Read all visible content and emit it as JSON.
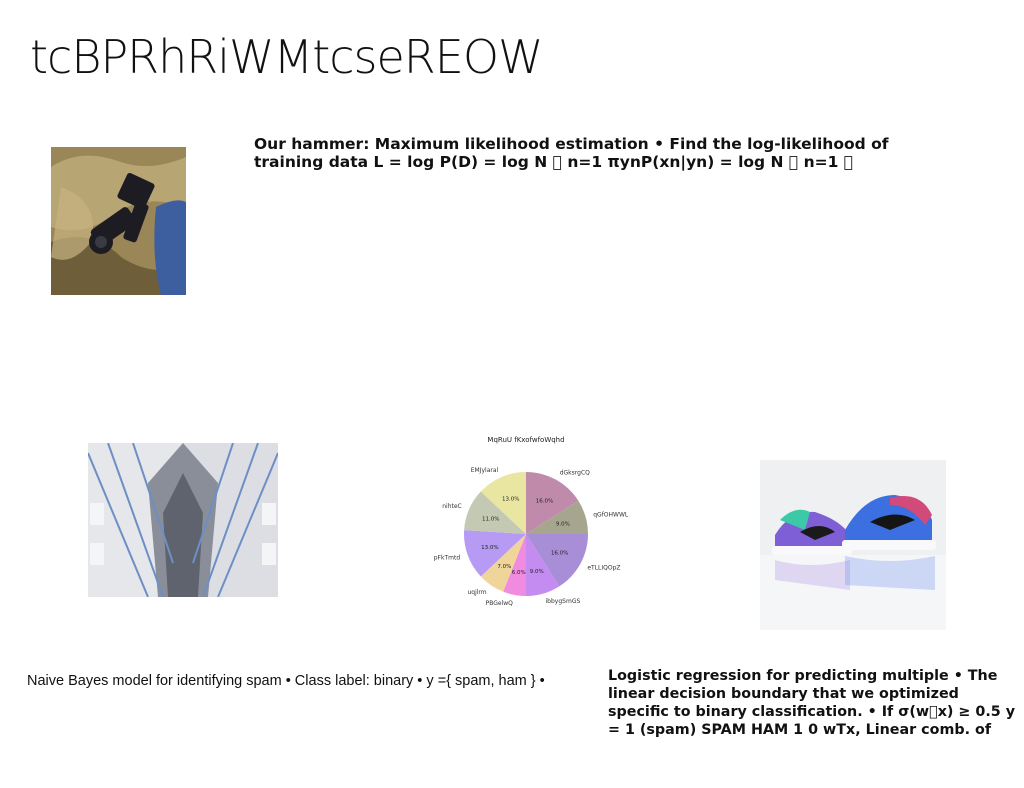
{
  "slide": {
    "title": "tcBPRhRiWMtcseREOW"
  },
  "text_blocks": {
    "top": "Our hammer: Maximum likelihood estimation • Find the log-likelihood of training data L = log P(D) = log N ￿ n=1 πynP(xn|yn) = log N ￿ n=1 ￿",
    "bottom_left": "Naive Bayes model for identifying spam • Class label: binary • y ={ spam, ham } •",
    "bottom_right": "Logistic regression for predicting multiple • The linear decision boundary that we optimized specific to binary classification. • If σ(w￿x) ≥ 0.5 y = 1 (spam) SPAM HAM 1 0 wTx, Linear comb. of"
  },
  "images": {
    "camera": "camera-photo",
    "building": "building-photo",
    "sneakers": "sneakers-photo"
  },
  "chart_data": {
    "type": "pie",
    "title": "MqRuU fKxofwfoWqhd",
    "slices": [
      {
        "label": "dGksrgCQ",
        "value": 16.0,
        "pct_label": "16.0%",
        "color": "#c08aab"
      },
      {
        "label": "qGfOHWWL",
        "value": 9.0,
        "pct_label": "9.0%",
        "color": "#a6a68f"
      },
      {
        "label": "eTLLIQOpZ",
        "value": 16.0,
        "pct_label": "16.0%",
        "color": "#a78ed6"
      },
      {
        "label": "ibbygSmGS",
        "value": 9.0,
        "pct_label": "9.0%",
        "color": "#c48cf0"
      },
      {
        "label": "PBGelwQ",
        "value": 6.0,
        "pct_label": "6.0%",
        "color": "#f08be0"
      },
      {
        "label": "uqjlrm",
        "value": 7.0,
        "pct_label": "7.0%",
        "color": "#f0d59a"
      },
      {
        "label": "pFkTmtd",
        "value": 13.0,
        "pct_label": "13.0%",
        "color": "#b79af4"
      },
      {
        "label": "nihteC",
        "value": 11.0,
        "pct_label": "11.0%",
        "color": "#c3c9b2"
      },
      {
        "label": "EMJylaral",
        "value": 13.0,
        "pct_label": "13.0%",
        "color": "#e8e6a0"
      }
    ]
  }
}
